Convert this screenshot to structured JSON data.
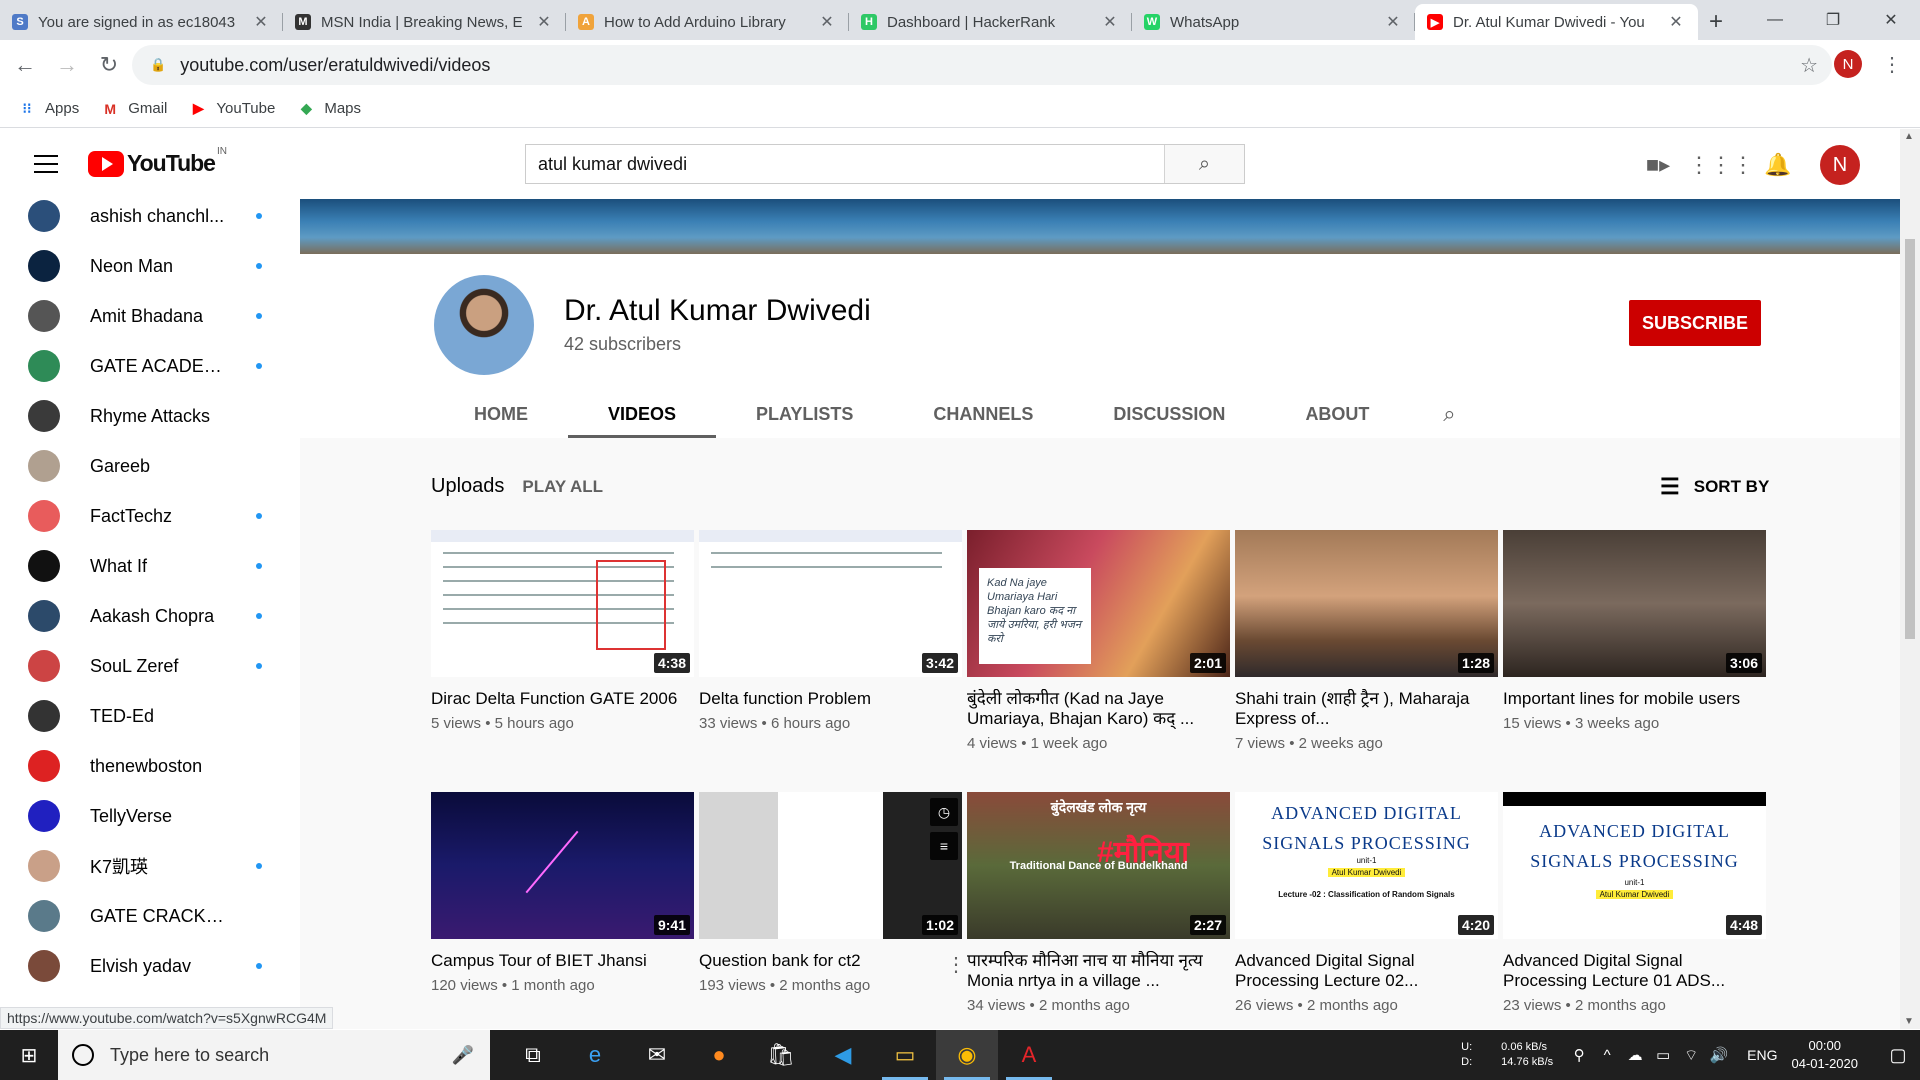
{
  "browser": {
    "tabs": [
      {
        "title": "You are signed in as ec18043",
        "icon": "s-icon",
        "color": "#4f7ac7",
        "glyph": "S"
      },
      {
        "title": "MSN India | Breaking News, E",
        "icon": "msn-icon",
        "color": "#333",
        "glyph": "M"
      },
      {
        "title": "How to Add Arduino Library",
        "icon": "arduino-icon",
        "color": "#f0a33b",
        "glyph": "A"
      },
      {
        "title": "Dashboard | HackerRank",
        "icon": "hackerrank-icon",
        "color": "#2ec866",
        "glyph": "H"
      },
      {
        "title": "WhatsApp",
        "icon": "whatsapp-icon",
        "color": "#25d366",
        "glyph": "W"
      },
      {
        "title": "Dr. Atul Kumar Dwivedi - You",
        "icon": "youtube-icon",
        "color": "#ff0000",
        "glyph": "▶"
      }
    ],
    "url": "youtube.com/user/eratuldwivedi/videos",
    "profile_initial": "N",
    "bookmarks": [
      {
        "label": "Apps",
        "icon": "apps-icon"
      },
      {
        "label": "Gmail",
        "icon": "gmail-icon"
      },
      {
        "label": "YouTube",
        "icon": "youtube-icon"
      },
      {
        "label": "Maps",
        "icon": "maps-icon"
      }
    ]
  },
  "youtube": {
    "logo_text": "YouTube",
    "country_code": "IN",
    "search_value": "atul kumar dwivedi",
    "user_initial": "N"
  },
  "sidebar": {
    "items": [
      {
        "name": "ashish chanchl...",
        "color": "#2b4f7a",
        "dot": true
      },
      {
        "name": "Neon Man",
        "color": "#0b2340",
        "dot": true
      },
      {
        "name": "Amit Bhadana",
        "color": "#555",
        "dot": true
      },
      {
        "name": "GATE ACADEMY",
        "color": "#2e8b57",
        "dot": true
      },
      {
        "name": "Rhyme Attacks",
        "color": "#3a3a3a",
        "dot": false
      },
      {
        "name": "Gareeb",
        "color": "#b0a090",
        "dot": false
      },
      {
        "name": "FactTechz",
        "color": "#e85c5c",
        "dot": true
      },
      {
        "name": "What If",
        "color": "#111",
        "dot": true
      },
      {
        "name": "Aakash Chopra",
        "color": "#2c4a6a",
        "dot": true
      },
      {
        "name": "SouL Zeref",
        "color": "#c44",
        "dot": true
      },
      {
        "name": "TED-Ed",
        "color": "#333",
        "dot": false
      },
      {
        "name": "thenewboston",
        "color": "#d22",
        "dot": false
      },
      {
        "name": "TellyVerse",
        "color": "#2020c0",
        "dot": false
      },
      {
        "name": "K7凱瑛",
        "color": "#c9a088",
        "dot": true
      },
      {
        "name": "GATE CRACKERS",
        "color": "#5a7a8a",
        "dot": false
      },
      {
        "name": "Elvish yadav",
        "color": "#7a4a3a",
        "dot": true
      }
    ]
  },
  "channel": {
    "name": "Dr. Atul Kumar Dwivedi",
    "subscribers": "42 subscribers",
    "subscribe_label": "SUBSCRIBE",
    "tabs": [
      "HOME",
      "VIDEOS",
      "PLAYLISTS",
      "CHANNELS",
      "DISCUSSION",
      "ABOUT"
    ],
    "active_tab": "VIDEOS",
    "section_title": "Uploads",
    "play_all": "PLAY ALL",
    "sort_label": "SORT BY"
  },
  "videos": [
    {
      "title": "Dirac Delta Function GATE 2006",
      "views": "5 views",
      "age": "5 hours ago",
      "duration": "4:38"
    },
    {
      "title": "Delta function Problem",
      "views": "33 views",
      "age": "6 hours ago",
      "duration": "3:42"
    },
    {
      "title": "बुंदेली लोकगीत (Kad na Jaye Umariaya, Bhajan Karo) कद् ...",
      "views": "4 views",
      "age": "1 week ago",
      "duration": "2:01",
      "overlay": "Kad Na jaye Umariaya Hari Bhajan karo कद ना जाये उमरिया, हरी भजन करो"
    },
    {
      "title": "Shahi train (शाही ट्रैन ), Maharaja Express of...",
      "views": "7 views",
      "age": "2 weeks ago",
      "duration": "1:28"
    },
    {
      "title": "Important lines for mobile users",
      "views": "15 views",
      "age": "3 weeks ago",
      "duration": "3:06"
    },
    {
      "title": "Campus Tour of BIET Jhansi",
      "views": "120 views",
      "age": "1 month ago",
      "duration": "9:41"
    },
    {
      "title": "Question bank for ct2",
      "views": "193 views",
      "age": "2 months ago",
      "duration": "1:02"
    },
    {
      "title": "पारम्परिक मौनिआ नाच या मौनिया नृत्य Monia nrtya in a village ...",
      "views": "34 views",
      "age": "2 months ago",
      "duration": "2:27",
      "overlay_top": "बुंदेलखंड लोक नृत्य",
      "overlay_big": "#मौनिया",
      "overlay_band": "Traditional Dance of Bundelkhand"
    },
    {
      "title": "Advanced Digital Signal Processing Lecture 02...",
      "views": "26 views",
      "age": "2 months ago",
      "duration": "4:20",
      "thumb_heading": "ADVANCED DIGITAL SIGNALS PROCESSING",
      "thumb_unit": "unit-1",
      "thumb_author": "Atul Kumar Dwivedi",
      "thumb_lecture": "Lecture -02 : Classification of Random Signals"
    },
    {
      "title": "Advanced Digital Signal Processing Lecture 01 ADS...",
      "views": "23 views",
      "age": "2 months ago",
      "duration": "4:48",
      "thumb_heading": "ADVANCED DIGITAL SIGNALS PROCESSING",
      "thumb_unit": "unit-1",
      "thumb_author": "Atul Kumar Dwivedi"
    }
  ],
  "status_url": "https://www.youtube.com/watch?v=s5XgnwRCG4M",
  "taskbar": {
    "search_placeholder": "Type here to search",
    "net_up_label": "U:",
    "net_up": "0.06 kB/s",
    "net_down_label": "D:",
    "net_down": "14.76 kB/s",
    "lang": "ENG",
    "time": "00:00",
    "date": "04-01-2020"
  }
}
